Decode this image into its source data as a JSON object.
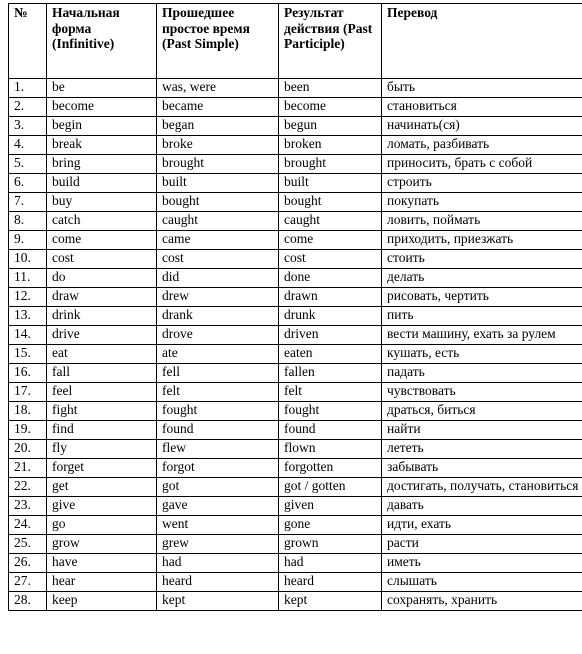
{
  "table": {
    "headers": {
      "num": "№",
      "infinitive": "Начальная форма (Infinitive)",
      "past_simple": "Прошедшее простое время (Past Simple)",
      "past_participle": "Результат действия (Past Participle)",
      "translation": "Перевод"
    },
    "rows": [
      {
        "num": "1.",
        "infinitive": "be",
        "past_simple": "was, were",
        "past_participle": "been",
        "translation": "быть"
      },
      {
        "num": "2.",
        "infinitive": "become",
        "past_simple": "became",
        "past_participle": "become",
        "translation": "становиться"
      },
      {
        "num": "3.",
        "infinitive": "begin",
        "past_simple": "began",
        "past_participle": "begun",
        "translation": "начинать(ся)"
      },
      {
        "num": "4.",
        "infinitive": "break",
        "past_simple": "broke",
        "past_participle": "broken",
        "translation": "ломать, разбивать"
      },
      {
        "num": "5.",
        "infinitive": "bring",
        "past_simple": "brought",
        "past_participle": "brought",
        "translation": "приносить, брать с собой"
      },
      {
        "num": "6.",
        "infinitive": "build",
        "past_simple": "built",
        "past_participle": "built",
        "translation": "строить"
      },
      {
        "num": "7.",
        "infinitive": "buy",
        "past_simple": "bought",
        "past_participle": "bought",
        "translation": "покупать"
      },
      {
        "num": "8.",
        "infinitive": "catch",
        "past_simple": "caught",
        "past_participle": "caught",
        "translation": "ловить, поймать"
      },
      {
        "num": "9.",
        "infinitive": "come",
        "past_simple": "came",
        "past_participle": "come",
        "translation": "приходить, приезжать"
      },
      {
        "num": "10.",
        "infinitive": "cost",
        "past_simple": "cost",
        "past_participle": "cost",
        "translation": "стоить"
      },
      {
        "num": "11.",
        "infinitive": "do",
        "past_simple": "did",
        "past_participle": "done",
        "translation": "делать"
      },
      {
        "num": "12.",
        "infinitive": "draw",
        "past_simple": "drew",
        "past_participle": "drawn",
        "translation": "рисовать, чертить"
      },
      {
        "num": "13.",
        "infinitive": "drink",
        "past_simple": "drank",
        "past_participle": "drunk",
        "translation": "пить"
      },
      {
        "num": "14.",
        "infinitive": "drive",
        "past_simple": "drove",
        "past_participle": "driven",
        "translation": "вести машину, ехать за рулем"
      },
      {
        "num": "15.",
        "infinitive": "eat",
        "past_simple": "ate",
        "past_participle": "eaten",
        "translation": "кушать, есть"
      },
      {
        "num": "16.",
        "infinitive": "fall",
        "past_simple": "fell",
        "past_participle": "fallen",
        "translation": "падать"
      },
      {
        "num": "17.",
        "infinitive": "feel",
        "past_simple": "felt",
        "past_participle": "felt",
        "translation": "чувствовать"
      },
      {
        "num": "18.",
        "infinitive": "fight",
        "past_simple": "fought",
        "past_participle": "fought",
        "translation": "драться, биться"
      },
      {
        "num": "19.",
        "infinitive": "find",
        "past_simple": "found",
        "past_participle": "found",
        "translation": "найти"
      },
      {
        "num": "20.",
        "infinitive": "fly",
        "past_simple": "flew",
        "past_participle": "flown",
        "translation": "лететь"
      },
      {
        "num": "21.",
        "infinitive": "forget",
        "past_simple": "forgot",
        "past_participle": "forgotten",
        "translation": "забывать"
      },
      {
        "num": "22.",
        "infinitive": "get",
        "past_simple": "got",
        "past_participle": "got / gotten",
        "translation": "достигать, получать, становиться"
      },
      {
        "num": "23.",
        "infinitive": "give",
        "past_simple": "gave",
        "past_participle": "given",
        "translation": "давать"
      },
      {
        "num": "24.",
        "infinitive": "go",
        "past_simple": "went",
        "past_participle": "gone",
        "translation": "идти, ехать"
      },
      {
        "num": "25.",
        "infinitive": "grow",
        "past_simple": "grew",
        "past_participle": "grown",
        "translation": "расти"
      },
      {
        "num": "26.",
        "infinitive": "have",
        "past_simple": "had",
        "past_participle": "had",
        "translation": "иметь"
      },
      {
        "num": "27.",
        "infinitive": "hear",
        "past_simple": "heard",
        "past_participle": "heard",
        "translation": "слышать"
      },
      {
        "num": "28.",
        "infinitive": "keep",
        "past_simple": "kept",
        "past_participle": "kept",
        "translation": "сохранять, хранить"
      }
    ]
  }
}
